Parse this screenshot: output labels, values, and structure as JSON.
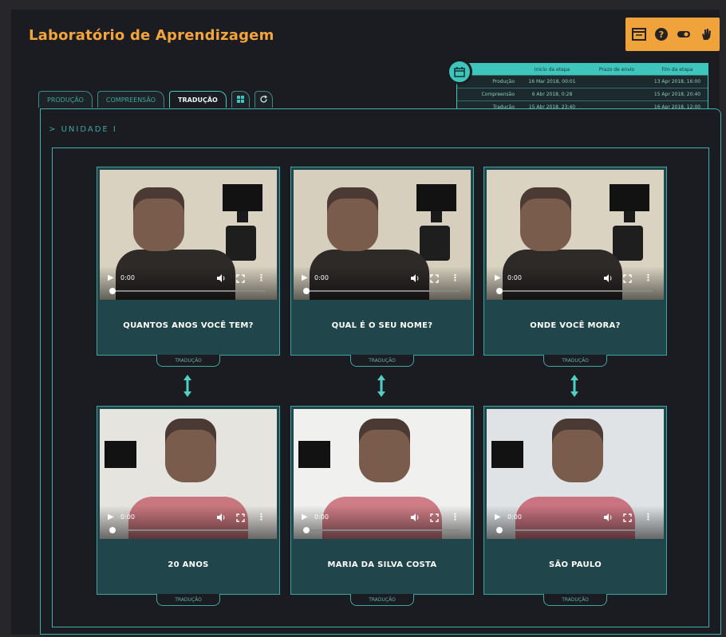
{
  "app": {
    "title": "Laboratório de Aprendizagem"
  },
  "toolbox": {
    "icons": [
      "window-icon",
      "help-icon",
      "toggle-icon",
      "hand-icon"
    ],
    "help_glyph": "?"
  },
  "tabs": [
    {
      "label": "PRODUÇÃO",
      "active": false
    },
    {
      "label": "COMPREENSÃO",
      "active": false
    },
    {
      "label": "TRADUÇÃO",
      "active": true
    }
  ],
  "dates_table": {
    "headers": [
      "",
      "Início da etapa",
      "Prazo de envio",
      "Fim da etapa"
    ],
    "rows": [
      {
        "stage": "Produção",
        "start": "16 Mar 2018, 00:01",
        "deadline": "",
        "end": "13 Apr 2018, 16:00"
      },
      {
        "stage": "Compreensão",
        "start": "6 Abr 2018, 0:28",
        "deadline": "",
        "end": "15 Apr 2018, 20:40"
      },
      {
        "stage": "Tradução",
        "start": "15 Abr 2018, 23:40",
        "deadline": "",
        "end": "16 Apr 2018, 12:00"
      }
    ]
  },
  "unit": {
    "label": "UNIDADE I"
  },
  "videos": {
    "time": "0:00",
    "tradution_label": "TRADUÇÃO",
    "questions": [
      {
        "caption": "QUANTOS ANOS VOCÊ TEM?"
      },
      {
        "caption": "QUAL É O SEU NOME?"
      },
      {
        "caption": "ONDE VOCÊ MORA?"
      }
    ],
    "answers": [
      {
        "caption": "20 ANOS"
      },
      {
        "caption": "MARIA DA SILVA COSTA"
      },
      {
        "caption": "SÃO PAULO"
      }
    ]
  },
  "colors": {
    "accent": "#3fc6bc",
    "brand": "#f2a53a",
    "caption_bg": "#20454a",
    "background": "#1b1b22"
  }
}
